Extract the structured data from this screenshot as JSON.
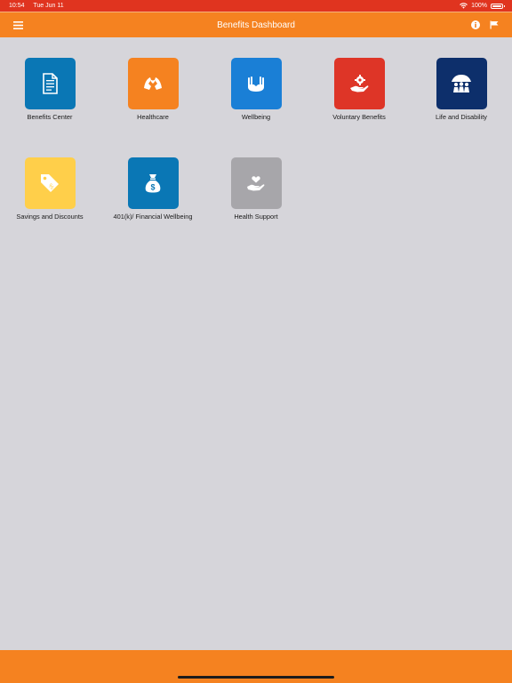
{
  "status_bar": {
    "time": "10:54",
    "date": "Tue Jun 11",
    "battery": "100%"
  },
  "navbar": {
    "title": "Benefits Dashboard",
    "menu_icon": "menu-icon",
    "info_icon": "info-icon",
    "flag_icon": "flag-icon"
  },
  "tiles": [
    {
      "label": "Benefits Center",
      "color": "#0a77b5",
      "icon": "document-icon"
    },
    {
      "label": "Healthcare",
      "color": "#f58220",
      "icon": "healthcare-icon"
    },
    {
      "label": "Wellbeing",
      "color": "#1a7fd6",
      "icon": "wellbeing-icon"
    },
    {
      "label": "Voluntary Benefits",
      "color": "#de3527",
      "icon": "voluntary-benefits-icon"
    },
    {
      "label": "Life and Disability",
      "color": "#0d2f6b",
      "icon": "umbrella-family-icon"
    },
    {
      "label": "Savings and Discounts",
      "color": "#ffcf4a",
      "icon": "price-tag-icon"
    },
    {
      "label": "401(k)/ Financial Wellbeing",
      "color": "#0a77b5",
      "icon": "money-bag-icon"
    },
    {
      "label": "Health Support",
      "color": "#a7a6aa",
      "icon": "heart-hand-icon"
    }
  ]
}
